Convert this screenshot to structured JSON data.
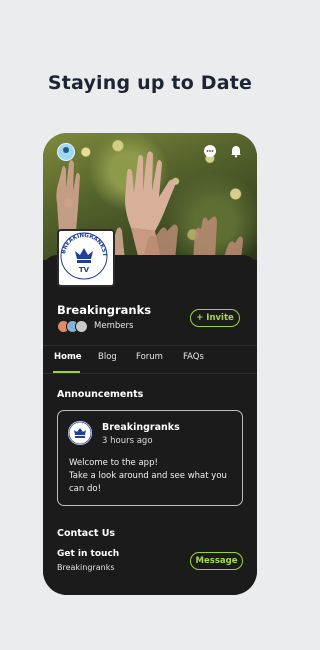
{
  "headline": "Staying up to Date",
  "group": {
    "name": "Breakingranks",
    "members_label": "Members",
    "invite_label": "+ Invite",
    "logo_text": "BREAKINGRANKSTV",
    "logo_bottom_text": "TV"
  },
  "tabs": [
    {
      "label": "Home",
      "active": true
    },
    {
      "label": "Blog",
      "active": false
    },
    {
      "label": "Forum",
      "active": false
    },
    {
      "label": "FAQs",
      "active": false
    }
  ],
  "announcements": {
    "title": "Announcements",
    "post": {
      "author": "Breakingranks",
      "time": "3 hours ago",
      "message_line1": "Welcome to the app!",
      "message_line2": "Take a look around and see what you can do!"
    }
  },
  "contact": {
    "title": "Contact Us",
    "get_in_touch": "Get in touch",
    "name": "Breakingranks",
    "message_label": "Message"
  },
  "icons": {
    "top_left": "user-avatar",
    "chat": "chat-bubble-icon",
    "notifications": "bell-icon"
  },
  "colors": {
    "accent": "#9cd13a",
    "panel": "#1b1b1b",
    "background": "#ebeced"
  }
}
